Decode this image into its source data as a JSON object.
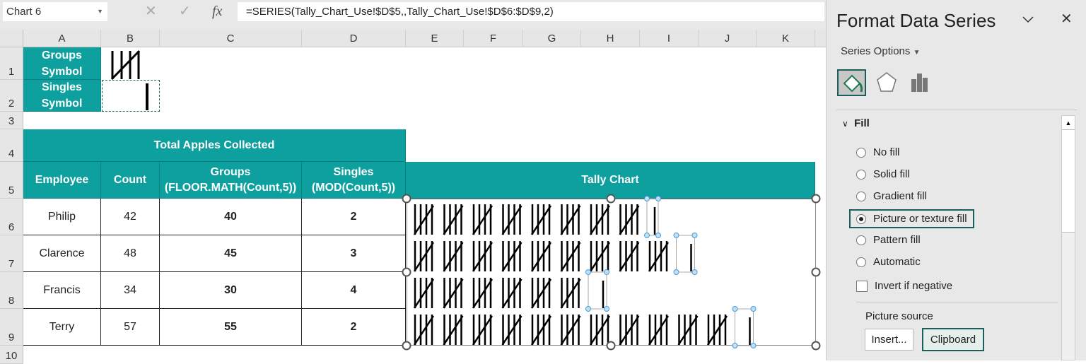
{
  "formula_bar": {
    "name_box": "Chart 6",
    "cancel_icon": "✕",
    "enter_icon": "✓",
    "fx_icon": "fx",
    "formula": "=SERIES(Tally_Chart_Use!$D$5,,Tally_Chart_Use!$D$6:$D$9,2)"
  },
  "columns": [
    "A",
    "B",
    "C",
    "D",
    "E",
    "F",
    "G",
    "H",
    "I",
    "J",
    "K"
  ],
  "rows": [
    "1",
    "2",
    "3",
    "4",
    "5",
    "6",
    "7",
    "8",
    "9",
    "10"
  ],
  "legend_cells": {
    "groups": "Groups Symbol",
    "singles": "Singles Symbol"
  },
  "table": {
    "title": "Total Apples Collected",
    "headers": [
      "Employee",
      "Count",
      "Groups (FLOOR.MATH(Count,5))",
      "Singles (MOD(Count,5))"
    ],
    "data": [
      [
        "Philip",
        "42",
        "40",
        "2"
      ],
      [
        "Clarence",
        "48",
        "45",
        "3"
      ],
      [
        "Francis",
        "34",
        "30",
        "4"
      ],
      [
        "Terry",
        "57",
        "55",
        "2"
      ]
    ]
  },
  "chart_data": {
    "type": "bar",
    "title": "Tally Chart",
    "categories": [
      "Philip",
      "Clarence",
      "Francis",
      "Terry"
    ],
    "series": [
      {
        "name": "Groups",
        "values": [
          40,
          45,
          30,
          55
        ]
      },
      {
        "name": "Singles",
        "values": [
          2,
          3,
          4,
          2
        ]
      }
    ],
    "units_per_group": 5
  },
  "panel": {
    "title": "Format Data Series",
    "collapse_icon": "chevron-down",
    "close_icon": "✕",
    "series_options": "Series Options",
    "section": "Fill",
    "options": [
      {
        "label": "No fill",
        "selected": false
      },
      {
        "label": "Solid fill",
        "selected": false
      },
      {
        "label": "Gradient fill",
        "selected": false
      },
      {
        "label": "Picture or texture fill",
        "selected": true
      },
      {
        "label": "Pattern fill",
        "selected": false
      },
      {
        "label": "Automatic",
        "selected": false
      }
    ],
    "invert": "Invert if negative",
    "picture_source": "Picture source",
    "insert": "Insert...",
    "clipboard": "Clipboard"
  },
  "colors": {
    "teal": "#0e9f9f"
  }
}
